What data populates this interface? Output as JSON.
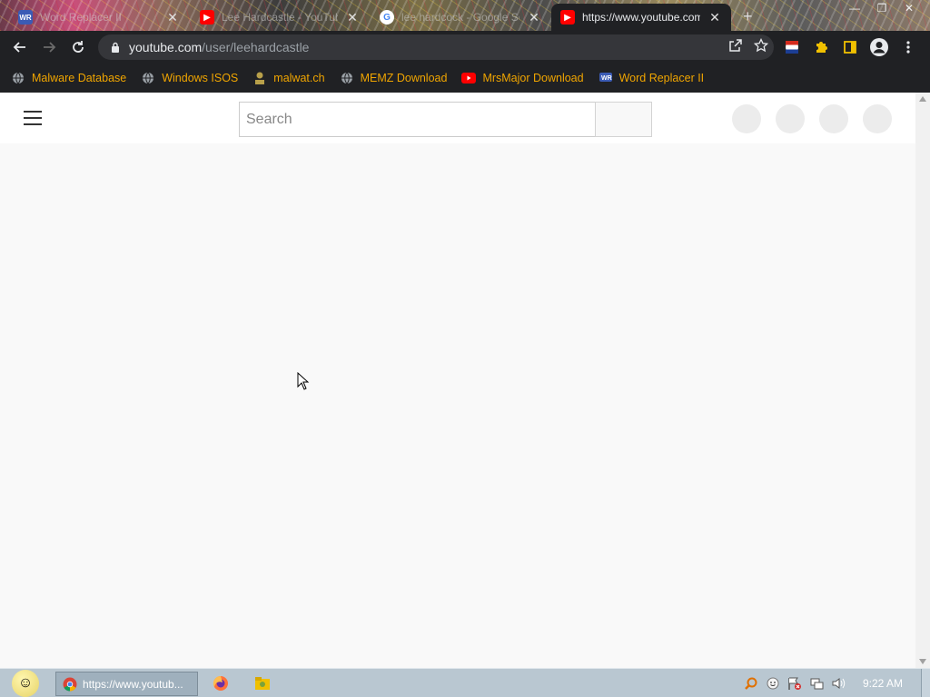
{
  "browser": {
    "tabs": [
      {
        "title": "Word Replacer II",
        "icon": "word-replacer-icon",
        "active": false
      },
      {
        "title": "Lee Hardcastle - YouTube",
        "icon": "youtube-icon",
        "active": false
      },
      {
        "title": "lee hardcock - Google Se",
        "icon": "google-icon",
        "active": false
      },
      {
        "title": "https://www.youtube.com",
        "icon": "youtube-icon",
        "active": true
      }
    ],
    "new_tab_label": "+",
    "url_host": "youtube.com",
    "url_path": "/user/leehardcastle"
  },
  "bookmarks": [
    {
      "label": "Malware Database",
      "icon": "globe-icon"
    },
    {
      "label": "Windows ISOS",
      "icon": "globe-icon"
    },
    {
      "label": "malwat.ch",
      "icon": "malwatch-icon"
    },
    {
      "label": "MEMZ Download",
      "icon": "globe-icon"
    },
    {
      "label": "MrsMajor Download",
      "icon": "youtube-icon"
    },
    {
      "label": "Word Replacer II",
      "icon": "word-replacer-icon"
    }
  ],
  "youtube": {
    "search_placeholder": "Search"
  },
  "taskbar": {
    "active_window": "https://www.youtub...",
    "clock": "9:22 AM"
  },
  "colors": {
    "bookmark_text": "#f0a500",
    "chrome_dark": "#202124",
    "youtube_red": "#ff0000",
    "taskbar": "#b9c7d1"
  }
}
